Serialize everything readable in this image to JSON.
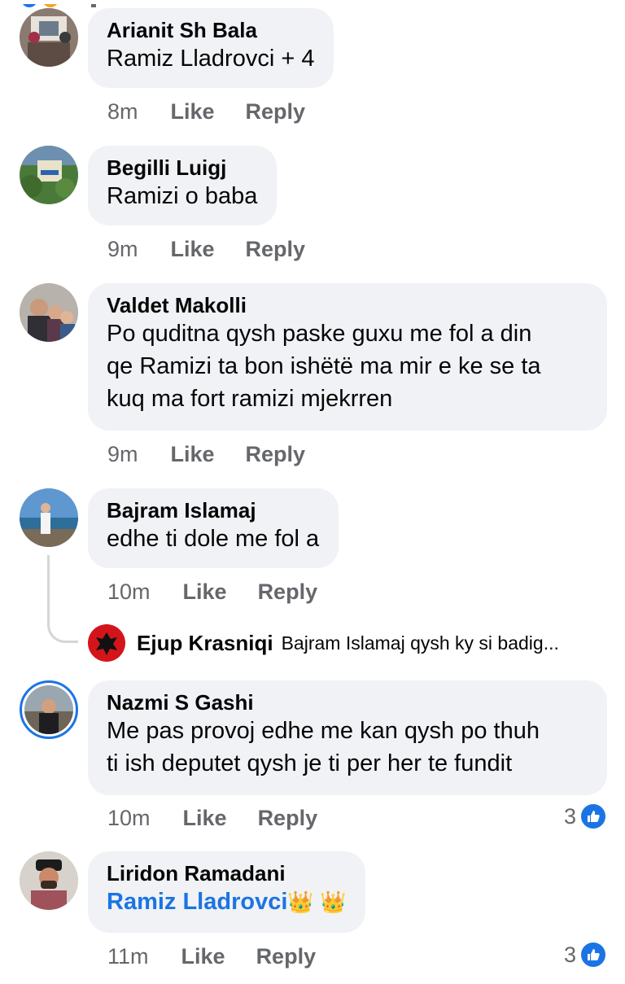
{
  "comments": [
    {
      "author": "Arianit Sh Bala",
      "text": "Ramiz Lladrovci + 4",
      "time": "8m"
    },
    {
      "author": "Begilli Luigj",
      "text": "Ramizi o baba",
      "time": "9m"
    },
    {
      "author": "Valdet Makolli",
      "lines": [
        "Po quditna qysh paske guxu me fol a din",
        "qe Ramizi ta bon ishëtë ma mir e ke se ta",
        "kuq ma fort ramizi mjekrren"
      ],
      "time": "9m"
    },
    {
      "author": "Bajram Islamaj",
      "text": "edhe ti dole me fol a",
      "time": "10m",
      "reply": {
        "author": "Ejup Krasniqi",
        "preview": "Bajram Islamaj qysh ky si badig..."
      }
    },
    {
      "author": "Nazmi S Gashi",
      "lines": [
        "Me pas provoj edhe me kan qysh po thuh",
        "ti ish deputet qysh je ti per her te fundit"
      ],
      "time": "10m",
      "reactions": "3"
    },
    {
      "author": "Liridon Ramadani",
      "mention": "Ramiz Lladrovci",
      "emoji": "👑 👑",
      "time": "11m",
      "reactions": "3"
    }
  ],
  "actions": {
    "like": "Like",
    "reply": "Reply"
  },
  "colors": {
    "accent": "#1b74e4",
    "bubble": "#f0f2f5",
    "meta": "#65676b"
  }
}
